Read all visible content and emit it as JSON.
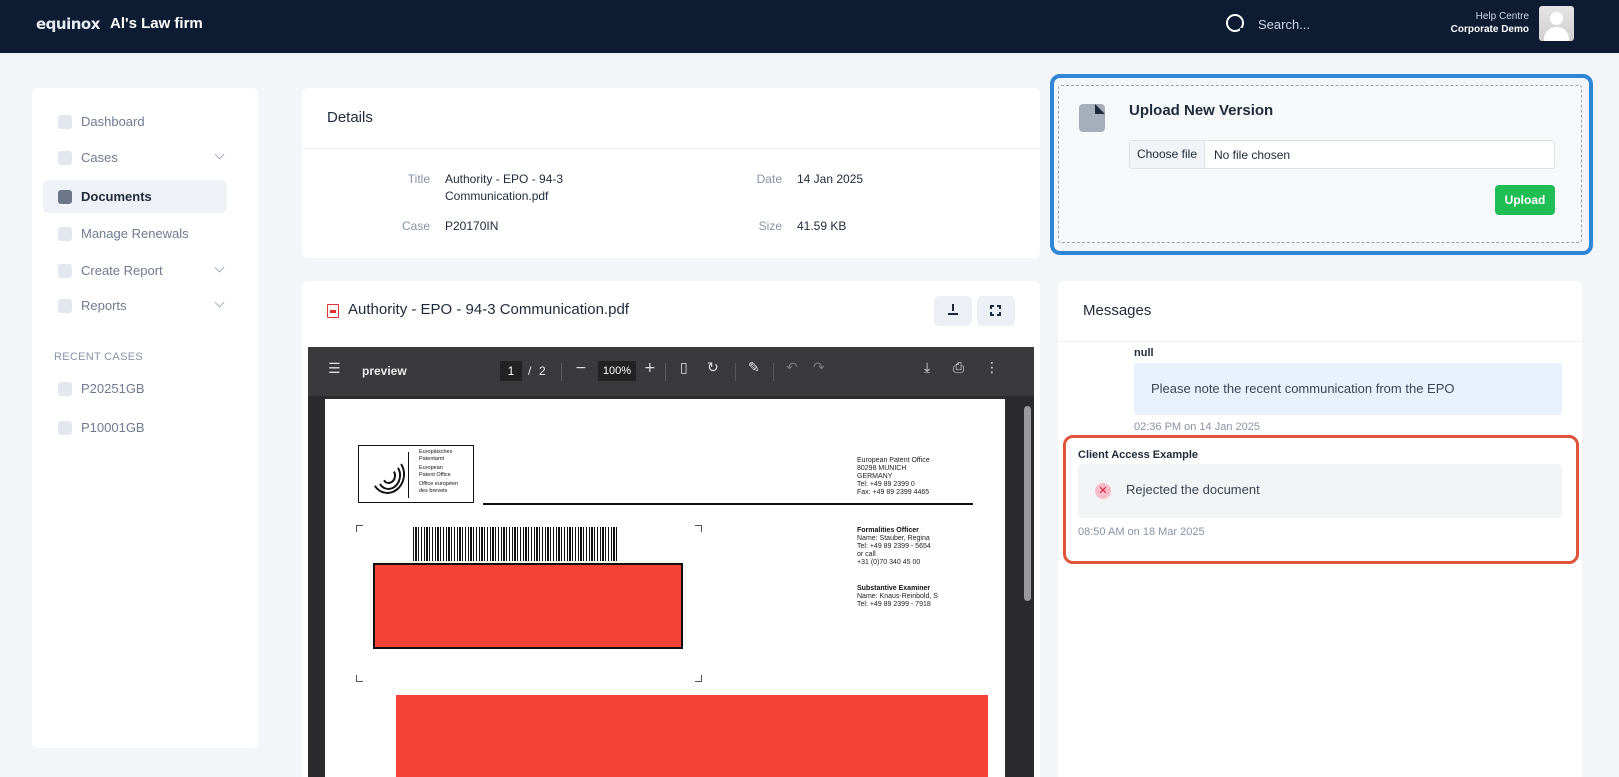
{
  "header": {
    "brand": "equinox",
    "firm_name": "Al's Law firm",
    "search_placeholder": "Search...",
    "help_centre": "Help Centre",
    "account": "Corporate Demo"
  },
  "sidebar": {
    "items": [
      {
        "label": "Dashboard",
        "icon": "dashboard-icon",
        "active": false
      },
      {
        "label": "Cases",
        "icon": "cases-icon",
        "active": false,
        "expandable": true
      },
      {
        "label": "Documents",
        "icon": "documents-icon",
        "active": true
      },
      {
        "label": "Manage Renewals",
        "icon": "renewals-icon",
        "active": false
      },
      {
        "label": "Create Report",
        "icon": "create-report-icon",
        "active": false,
        "expandable": true
      },
      {
        "label": "Reports",
        "icon": "reports-icon",
        "active": false,
        "expandable": true
      }
    ],
    "recent_label": "RECENT CASES",
    "recent_cases": [
      "P20251GB",
      "P10001GB"
    ]
  },
  "details": {
    "heading": "Details",
    "title_label": "Title",
    "title_value_line1": "Authority - EPO - 94-3",
    "title_value_line2": "Communication.pdf",
    "date_label": "Date",
    "date_value": "14 Jan 2025",
    "case_label": "Case",
    "case_value": "P20170IN",
    "size_label": "Size",
    "size_value": "41.59 KB"
  },
  "upload": {
    "heading": "Upload New Version",
    "choose_file": "Choose file",
    "no_file": "No file chosen",
    "button": "Upload"
  },
  "viewer": {
    "file_name": "Authority - EPO - 94-3 Communication.pdf",
    "toolbar": {
      "title": "preview",
      "page_current": "1",
      "page_sep": "/",
      "page_total": "2",
      "zoom": "100%"
    },
    "letter": {
      "logo_lines": [
        "Europäisches",
        "Patentamt",
        "European",
        "Patent Office",
        "Office européen",
        "des brevets"
      ],
      "address_lines": [
        "European Patent Office",
        "80298 MUNICH",
        "GERMANY",
        "Tel: +49 89 2399 0",
        "Fax: +49 89 2399 4465"
      ],
      "officer_heading": "Formalities Officer",
      "officer_lines": [
        "Name: Stauber, Regina",
        "Tel: +49 89 2399 - 5654",
        "or call",
        "+31 (0)70 340 45 00"
      ],
      "examiner_heading": "Substantive Examiner",
      "examiner_lines": [
        "Name: Knaus-Reinbold, S",
        "Tel: +49 89 2399 - 7918"
      ]
    }
  },
  "messages": {
    "heading": "Messages",
    "items": [
      {
        "author": "null",
        "text": "Please note the recent communication from the EPO",
        "time": "02:36 PM on 14 Jan 2025"
      },
      {
        "author": "Client Access Example",
        "text": "Rejected the document",
        "time": "08:50 AM on 18 Mar 2025",
        "status_icon": "rejected-icon"
      }
    ]
  },
  "colors": {
    "topbar": "#0d1b33",
    "upload_button": "#1fbe55",
    "upload_highlight": "#2f86d6",
    "message_highlight": "#e2533b",
    "redaction": "#f44336"
  }
}
